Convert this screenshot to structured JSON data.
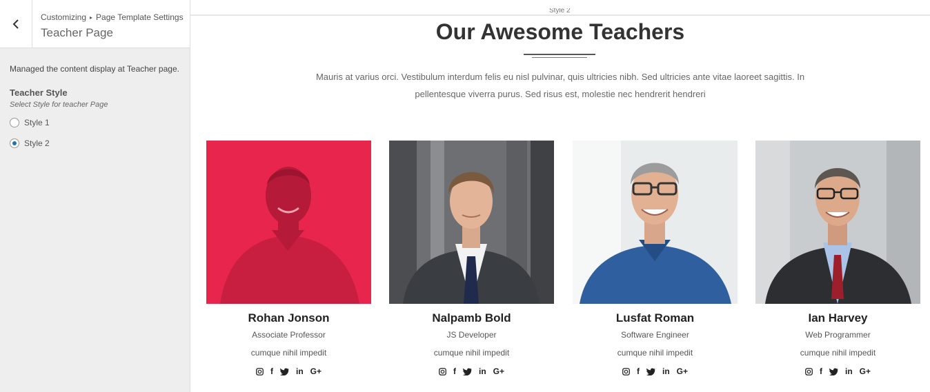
{
  "customizer": {
    "breadcrumb": {
      "parent": "Customizing",
      "separator": "▸",
      "section": "Page Template Settings"
    },
    "title": "Teacher Page",
    "description": "Managed the content display at Teacher page.",
    "control": {
      "label": "Teacher Style",
      "help": "Select Style for teacher Page",
      "options": [
        {
          "label": "Style 1",
          "checked": false
        },
        {
          "label": "Style 2",
          "checked": true
        }
      ]
    }
  },
  "preview": {
    "clipped_label": "Style 2",
    "heading": "Our Awesome Teachers",
    "intro": "Mauris at varius orci. Vestibulum interdum felis eu nisl pulvinar, quis ultricies nibh. Sed ultricies ante vitae laoreet sagittis. In pellentesque viverra purus. Sed risus est, molestie nec hendrerit hendreri",
    "accent_color": "#e8264d",
    "teachers": [
      {
        "name": "Rohan Jonson",
        "role": "Associate Professor",
        "tagline": "cumque nihil impedit",
        "highlighted": true
      },
      {
        "name": "Nalpamb Bold",
        "role": "JS Developer",
        "tagline": "cumque nihil impedit",
        "highlighted": false
      },
      {
        "name": "Lusfat Roman",
        "role": "Software Engineer",
        "tagline": "cumque nihil impedit",
        "highlighted": false
      },
      {
        "name": "Ian Harvey",
        "role": "Web Programmer",
        "tagline": "cumque nihil impedit",
        "highlighted": false
      }
    ],
    "socials": [
      "instagram-icon",
      "facebook-icon",
      "twitter-icon",
      "linkedin-icon",
      "google-plus-icon"
    ],
    "social_text": {
      "facebook": "f",
      "linkedin": "in",
      "google_plus": "G+"
    }
  }
}
